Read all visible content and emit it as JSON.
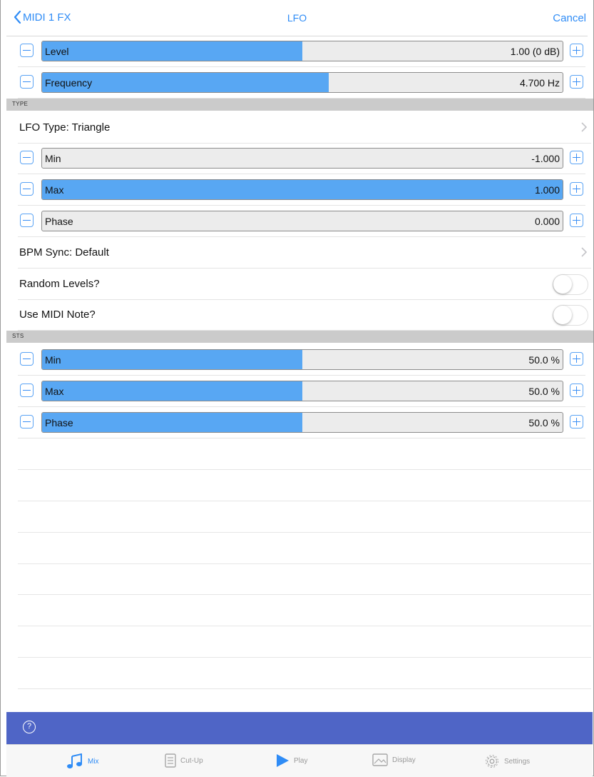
{
  "nav": {
    "back_label": "MIDI 1 FX",
    "title": "LFO",
    "cancel_label": "Cancel"
  },
  "sliders_top": [
    {
      "label": "Level",
      "value": "1.00 (0 dB)",
      "fill_fraction": 0.5
    },
    {
      "label": "Frequency",
      "value": "4.700 Hz",
      "fill_fraction": 0.55
    }
  ],
  "section_type": {
    "label": "TYPE"
  },
  "lfo_type": {
    "label": "LFO Type: Triangle"
  },
  "sliders_type": [
    {
      "label": "Min",
      "value": "-1.000",
      "fill_fraction": 0.0
    },
    {
      "label": "Max",
      "value": "1.000",
      "fill_fraction": 1.0
    },
    {
      "label": "Phase",
      "value": "0.000",
      "fill_fraction": 0.0
    }
  ],
  "bpm_sync": {
    "label": "BPM Sync: Default"
  },
  "random_levels": {
    "label": "Random Levels?",
    "on": false
  },
  "use_midi_note": {
    "label": "Use MIDI Note?",
    "on": false
  },
  "section_sts": {
    "label": "STS"
  },
  "sliders_sts": [
    {
      "label": "Min",
      "value": "50.0 %",
      "fill_fraction": 0.5
    },
    {
      "label": "Max",
      "value": "50.0 %",
      "fill_fraction": 0.5
    },
    {
      "label": "Phase",
      "value": "50.0 %",
      "fill_fraction": 0.5
    }
  ],
  "help": {
    "icon_glyph": "?"
  },
  "tabs": [
    {
      "label": "Mix",
      "icon": "music-note-icon",
      "active": true
    },
    {
      "label": "Cut-Up",
      "icon": "document-icon",
      "active": false
    },
    {
      "label": "Play",
      "icon": "play-icon",
      "active": false
    },
    {
      "label": "Display",
      "icon": "image-icon",
      "active": false
    },
    {
      "label": "Settings",
      "icon": "gear-icon",
      "active": false
    }
  ],
  "colors": {
    "accent": "#2f8cf6",
    "slider_fill": "#58a7f3",
    "help_bar": "#4f65c6",
    "section_header": "#cbcbcb"
  }
}
